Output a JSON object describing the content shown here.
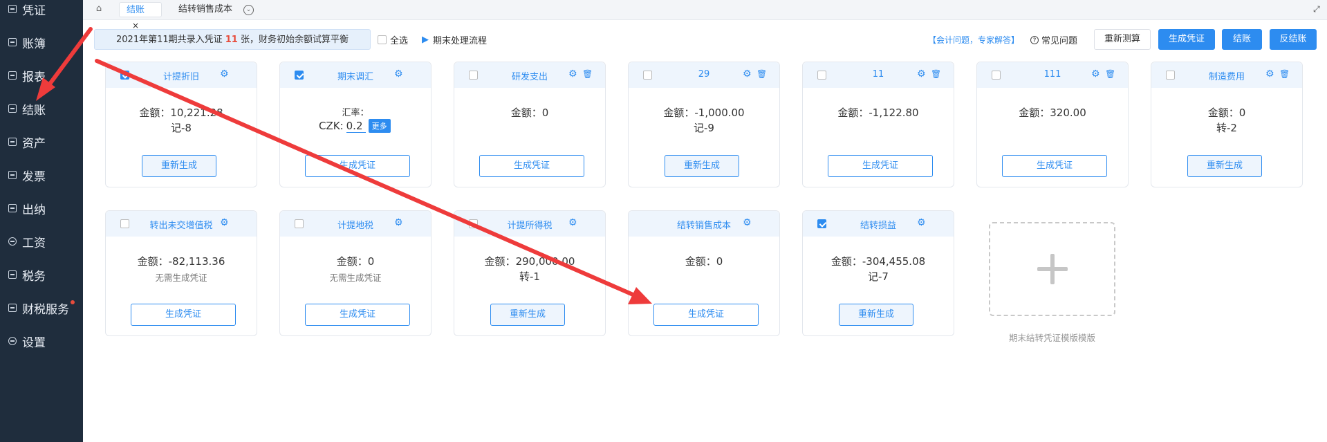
{
  "sidebar": {
    "items": [
      {
        "label": "凭证",
        "icon": "voucher-icon"
      },
      {
        "label": "账簿",
        "icon": "ledger-icon"
      },
      {
        "label": "报表",
        "icon": "report-icon"
      },
      {
        "label": "结账",
        "icon": "closing-icon"
      },
      {
        "label": "资产",
        "icon": "asset-icon"
      },
      {
        "label": "发票",
        "icon": "invoice-icon"
      },
      {
        "label": "出纳",
        "icon": "cashier-icon"
      },
      {
        "label": "工资",
        "icon": "salary-icon"
      },
      {
        "label": "税务",
        "icon": "tax-icon"
      },
      {
        "label": "财税服务",
        "icon": "service-icon"
      },
      {
        "label": "设置",
        "icon": "settings-icon"
      }
    ]
  },
  "tabs": {
    "home_icon": "⌂",
    "items": [
      {
        "label": "结账",
        "close": "×"
      },
      {
        "label": "结转销售成本"
      }
    ],
    "more_icon": "⌄",
    "expand_icon": "⤢"
  },
  "toolbar": {
    "notice_prefix": "2021年第11期共录入凭证 ",
    "notice_count": "11",
    "notice_suffix": " 张，财务初始余额试算平衡",
    "select_all": "全选",
    "flow_label": "期末处理流程",
    "expert_link": "【会计问题，专家解答】",
    "faq_icon": "?",
    "faq_label": "常见问题",
    "buttons": {
      "recalc": "重新测算",
      "gen_voucher": "生成凭证",
      "close": "结账",
      "reverse": "反结账"
    }
  },
  "cards": {
    "c1": {
      "title": "计提折旧",
      "amount_label": "金额：",
      "amount": "10,221.28",
      "voucher": "记-8",
      "button": "重新生成"
    },
    "c2": {
      "title": "期末调汇",
      "rate_label": "汇率：",
      "currency": "CZK:",
      "rate": "0.2",
      "more": "更多",
      "button": "生成凭证"
    },
    "c3": {
      "title": "研发支出",
      "amount_label": "金额：",
      "amount": "0",
      "button": "生成凭证"
    },
    "c4": {
      "title": "29",
      "amount_label": "金额：",
      "amount": "-1,000.00",
      "voucher": "记-9",
      "button": "重新生成"
    },
    "c5": {
      "title": "11",
      "amount_label": "金额：",
      "amount": "-1,122.80",
      "button": "生成凭证"
    },
    "c6": {
      "title": "111",
      "amount_label": "金额：",
      "amount": "320.00",
      "button": "生成凭证"
    },
    "c7": {
      "title": "制造费用",
      "amount_label": "金额：",
      "amount": "0",
      "voucher": "转-2",
      "button": "重新生成"
    },
    "c8": {
      "title": "转出未交增值税",
      "amount_label": "金额：",
      "amount": "-82,113.36",
      "note": "无需生成凭证",
      "button": "生成凭证"
    },
    "c9": {
      "title": "计提地税",
      "amount_label": "金额：",
      "amount": "0",
      "note": "无需生成凭证",
      "button": "生成凭证"
    },
    "c10": {
      "title": "计提所得税",
      "amount_label": "金额：",
      "amount": "290,000.00",
      "voucher": "转-1",
      "button": "重新生成"
    },
    "c11": {
      "title": "结转销售成本",
      "amount_label": "金额：",
      "amount": "0",
      "button": "生成凭证"
    },
    "c12": {
      "title": "结转损益",
      "amount_label": "金额：",
      "amount": "-304,455.08",
      "voucher": "记-7",
      "button": "重新生成"
    }
  },
  "add_template": {
    "label": "期末结转凭证模版模版"
  },
  "icons": {
    "gear": "⚙",
    "trash": "🗑",
    "video": "▶"
  },
  "colors": {
    "accent": "#2d8cf0",
    "sidebar_bg": "#1f2d3d",
    "highlight": "#e74c3c",
    "annotation": "#ee3b3b"
  }
}
